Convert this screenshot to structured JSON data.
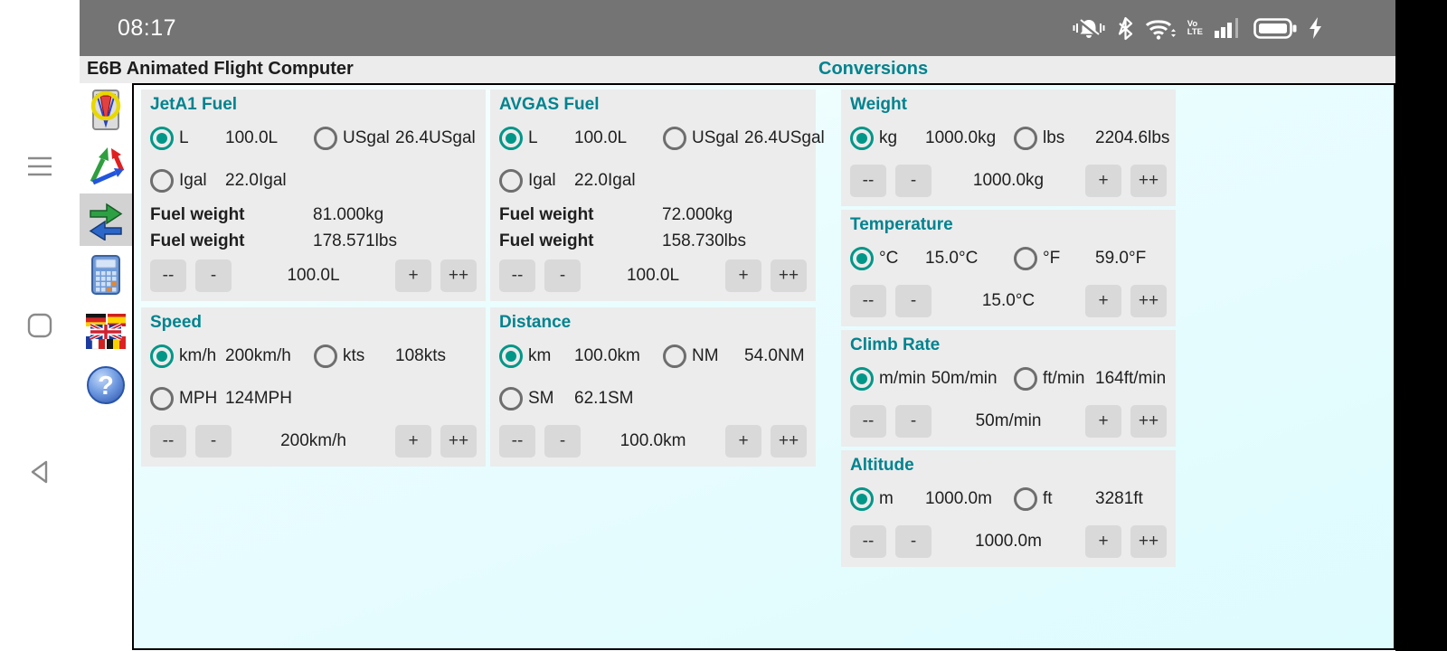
{
  "status_bar": {
    "time": "08:17",
    "volte_line1": "Vo",
    "volte_line2": "LTE"
  },
  "title_bar": {
    "app_title": "E6B Animated Flight Computer",
    "screen_title": "Conversions"
  },
  "colors": {
    "accent_teal": "#00838f",
    "radio_teal": "#009688",
    "panel_bg": "#ececec",
    "button_bg": "#d9d9d9",
    "status_bar_bg": "#747474",
    "content_cyan": "#defbfe"
  },
  "sidebar": {
    "items": [
      {
        "name": "whiz-wheel"
      },
      {
        "name": "wind-triangle"
      },
      {
        "name": "conversions",
        "selected": true
      },
      {
        "name": "calculator"
      },
      {
        "name": "language-flags"
      },
      {
        "name": "help"
      }
    ]
  },
  "columns": [
    {
      "panels": [
        {
          "title": "JetA1 Fuel",
          "radio_rows": [
            [
              {
                "label": "L",
                "value": "100.0L",
                "selected": true
              },
              {
                "label": "USgal",
                "value": "26.4USgal",
                "selected": false
              }
            ],
            [
              {
                "label": "Igal",
                "value": "22.0Igal",
                "selected": false
              }
            ]
          ],
          "info_rows": [
            {
              "label": "Fuel weight",
              "value": "81.000kg"
            },
            {
              "label": "Fuel weight",
              "value": "178.571lbs"
            }
          ],
          "stepper": {
            "buttons": [
              "--",
              "-",
              "+",
              "++"
            ],
            "value": "100.0L"
          }
        },
        {
          "title": "Speed",
          "radio_rows": [
            [
              {
                "label": "km/h",
                "value": "200km/h",
                "selected": true
              },
              {
                "label": "kts",
                "value": "108kts",
                "selected": false
              }
            ],
            [
              {
                "label": "MPH",
                "value": "124MPH",
                "selected": false
              }
            ]
          ],
          "stepper": {
            "buttons": [
              "--",
              "-",
              "+",
              "++"
            ],
            "value": "200km/h"
          }
        }
      ]
    },
    {
      "panels": [
        {
          "title": "AVGAS Fuel",
          "radio_rows": [
            [
              {
                "label": "L",
                "value": "100.0L",
                "selected": true
              },
              {
                "label": "USgal",
                "value": "26.4USgal",
                "selected": false
              }
            ],
            [
              {
                "label": "Igal",
                "value": "22.0Igal",
                "selected": false
              }
            ]
          ],
          "info_rows": [
            {
              "label": "Fuel weight",
              "value": "72.000kg"
            },
            {
              "label": "Fuel weight",
              "value": "158.730lbs"
            }
          ],
          "stepper": {
            "buttons": [
              "--",
              "-",
              "+",
              "++"
            ],
            "value": "100.0L"
          }
        },
        {
          "title": "Distance",
          "radio_rows": [
            [
              {
                "label": "km",
                "value": "100.0km",
                "selected": true
              },
              {
                "label": "NM",
                "value": "54.0NM",
                "selected": false
              }
            ],
            [
              {
                "label": "SM",
                "value": "62.1SM",
                "selected": false
              }
            ]
          ],
          "stepper": {
            "buttons": [
              "--",
              "-",
              "+",
              "++"
            ],
            "value": "100.0km"
          }
        }
      ]
    },
    {
      "panels": [
        {
          "title": "Weight",
          "radio_rows": [
            [
              {
                "label": "kg",
                "value": "1000.0kg",
                "selected": true
              },
              {
                "label": "lbs",
                "value": "2204.6lbs",
                "selected": false
              }
            ]
          ],
          "stepper": {
            "buttons": [
              "--",
              "-",
              "+",
              "++"
            ],
            "value": "1000.0kg"
          }
        },
        {
          "title": "Temperature",
          "radio_rows": [
            [
              {
                "label": "°C",
                "value": "15.0°C",
                "selected": true
              },
              {
                "label": "°F",
                "value": "59.0°F",
                "selected": false
              }
            ]
          ],
          "stepper": {
            "buttons": [
              "--",
              "-",
              "+",
              "++"
            ],
            "value": "15.0°C"
          }
        },
        {
          "title": "Climb Rate",
          "radio_rows": [
            [
              {
                "label": "m/min",
                "value": "50m/min",
                "selected": true
              },
              {
                "label": "ft/min",
                "value": "164ft/min",
                "selected": false
              }
            ]
          ],
          "stepper": {
            "buttons": [
              "--",
              "-",
              "+",
              "++"
            ],
            "value": "50m/min"
          }
        },
        {
          "title": "Altitude",
          "radio_rows": [
            [
              {
                "label": "m",
                "value": "1000.0m",
                "selected": true
              },
              {
                "label": "ft",
                "value": "3281ft",
                "selected": false
              }
            ]
          ],
          "stepper": {
            "buttons": [
              "--",
              "-",
              "+",
              "++"
            ],
            "value": "1000.0m"
          }
        }
      ]
    }
  ]
}
